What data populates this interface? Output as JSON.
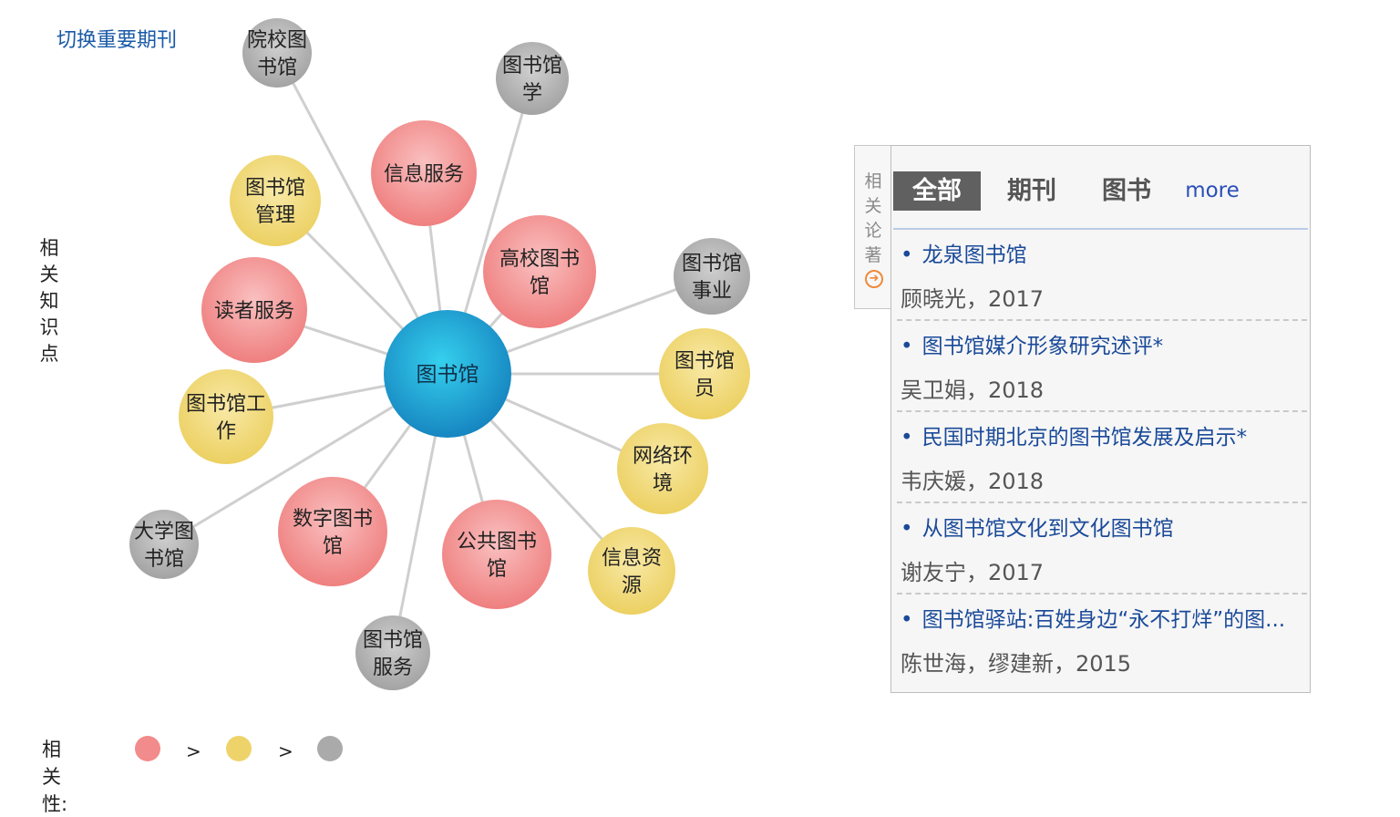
{
  "switch_link": "切换重要期刊",
  "side_label": "相关知识点",
  "graph": {
    "center": "图书馆",
    "nodes": [
      {
        "lines": [
          "院校图",
          "书馆"
        ],
        "level": 3
      },
      {
        "lines": [
          "图书馆",
          "学"
        ],
        "level": 3
      },
      {
        "lines": [
          "信息服务"
        ],
        "level": 1
      },
      {
        "lines": [
          "图书馆",
          "管理"
        ],
        "level": 2
      },
      {
        "lines": [
          "高校图书",
          "馆"
        ],
        "level": 1
      },
      {
        "lines": [
          "图书馆",
          "事业"
        ],
        "level": 3
      },
      {
        "lines": [
          "读者服务"
        ],
        "level": 1
      },
      {
        "lines": [
          "图书馆",
          "员"
        ],
        "level": 2
      },
      {
        "lines": [
          "图书馆工",
          "作"
        ],
        "level": 2
      },
      {
        "lines": [
          "网络环",
          "境"
        ],
        "level": 2
      },
      {
        "lines": [
          "数字图书",
          "馆"
        ],
        "level": 1
      },
      {
        "lines": [
          "公共图书",
          "馆"
        ],
        "level": 1
      },
      {
        "lines": [
          "信息资",
          "源"
        ],
        "level": 2
      },
      {
        "lines": [
          "大学图",
          "书馆"
        ],
        "level": 3
      },
      {
        "lines": [
          "图书馆",
          "服务"
        ],
        "level": 3
      }
    ],
    "colors": {
      "level1": "#f28b8b",
      "level2": "#eed36a",
      "level3": "#aaaaaa",
      "center": "#1e9fd3"
    }
  },
  "legend": {
    "label": "相关性:",
    "gt": ">"
  },
  "panel": {
    "side_tab_label": "相关论著",
    "tabs": [
      {
        "label": "全部",
        "active": true
      },
      {
        "label": "期刊",
        "active": false
      },
      {
        "label": "图书",
        "active": false
      },
      {
        "label": "more",
        "active": false
      }
    ],
    "items": [
      {
        "title": "龙泉图书馆",
        "meta": "顾晓光，2017"
      },
      {
        "title": "图书馆媒介形象研究述评*",
        "meta": "吴卫娟，2018"
      },
      {
        "title": "民国时期北京的图书馆发展及启示*",
        "meta": "韦庆媛，2018"
      },
      {
        "title": "从图书馆文化到文化图书馆",
        "meta": "谢友宁，2017"
      },
      {
        "title": "图书馆驿站:百姓身边“永不打烊”的图...",
        "meta": "陈世海，缪建新，2015"
      }
    ]
  }
}
